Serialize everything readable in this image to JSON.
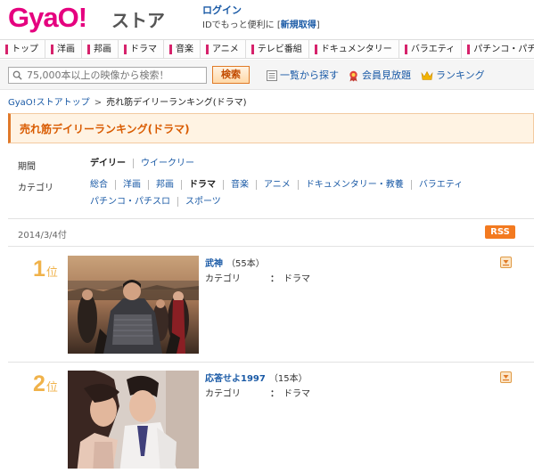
{
  "header": {
    "logo": "GyaO!",
    "store": "ストア",
    "login_link": "ログイン",
    "login_sub_prefix": "IDでもっと便利に [",
    "register_link": "新規取得",
    "login_sub_suffix": "]"
  },
  "nav": {
    "items": [
      "トップ",
      "洋画",
      "邦画",
      "ドラマ",
      "音楽",
      "アニメ",
      "テレビ番組",
      "ドキュメンタリー",
      "バラエティ",
      "パチンコ・パチスロ"
    ]
  },
  "search": {
    "placeholder": "75,000本以上の映像から検索！",
    "button": "検索",
    "tools": [
      "一覧から探す",
      "会員見放題",
      "ランキング"
    ]
  },
  "breadcrumb": {
    "home": "GyaO!ストアトップ",
    "separator": ">",
    "current": "売れ筋デイリーランキング(ドラマ)"
  },
  "page_title": "売れ筋デイリーランキング(ドラマ)",
  "filters": {
    "period_label": "期間",
    "period_options": [
      "デイリー",
      "ウイークリー"
    ],
    "category_label": "カテゴリ",
    "category_row1": [
      "総合",
      "洋画",
      "邦画",
      "ドラマ",
      "音楽",
      "アニメ",
      "ドキュメンタリー・教養",
      "バラエティ"
    ],
    "category_row2": [
      "パチンコ・パチスロ",
      "スポーツ"
    ]
  },
  "date": "2014/3/4付",
  "rss": "RSS",
  "rankings": [
    {
      "rank": "1",
      "suffix": "位",
      "title": "武神",
      "count": "（55本）",
      "meta_label": "カテゴリ",
      "colon": "：",
      "meta_value": "ドラマ"
    },
    {
      "rank": "2",
      "suffix": "位",
      "title": "応答せよ1997",
      "count": "（15本）",
      "meta_label": "カテゴリ",
      "colon": "：",
      "meta_value": "ドラマ"
    }
  ],
  "colors": {
    "brand": "#e5007f",
    "link": "#1a5aa6",
    "title_orange": "#d95b00",
    "rank": "#f0b24a",
    "rss": "#f37a20"
  }
}
